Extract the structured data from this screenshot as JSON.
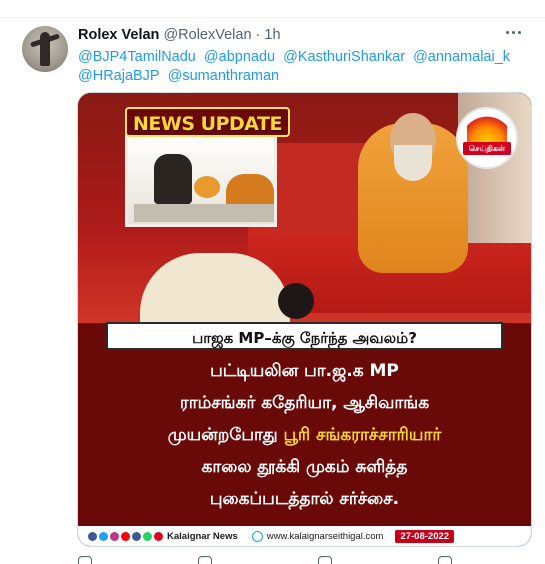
{
  "tweet": {
    "author_name": "Rolex Velan",
    "author_handle": "@RolexVelan",
    "separator": "·",
    "time": "1h",
    "mentions": [
      "@BJP4TamilNadu",
      "@abpnadu",
      "@KasthuriShankar",
      "@annamalai_k",
      "@HRajaBJP",
      "@sumanthraman"
    ]
  },
  "media": {
    "badge": "NEWS UPDATE",
    "logo_text": "செய்திகள்",
    "banner": "பாஜக MP–க்கு நேர்ந்த அவலம்?",
    "lines": [
      {
        "white": "பட்டியலின பா.ஜ.க MP",
        "yellow": ""
      },
      {
        "white": "ராம்சங்கர் கதேரியா, ஆசிவாங்க",
        "yellow": ""
      },
      {
        "white": "முயன்றபோது ",
        "yellow": "பூரி சங்கராச்சாரியார்"
      },
      {
        "white": "காலை தூக்கி முகம் சுளித்த",
        "yellow": ""
      },
      {
        "white": "புகைப்படத்தால் சர்ச்சை.",
        "yellow": ""
      }
    ],
    "footer": {
      "brand": "Kalaignar News",
      "site": "www.kalaignarseithigal.com",
      "date": "27-08-2022"
    }
  },
  "colors": {
    "link": "#1d9bf0",
    "secondary_text": "#536471",
    "headline_yellow": "#ffd92e",
    "media_background": "#6a0a08"
  }
}
